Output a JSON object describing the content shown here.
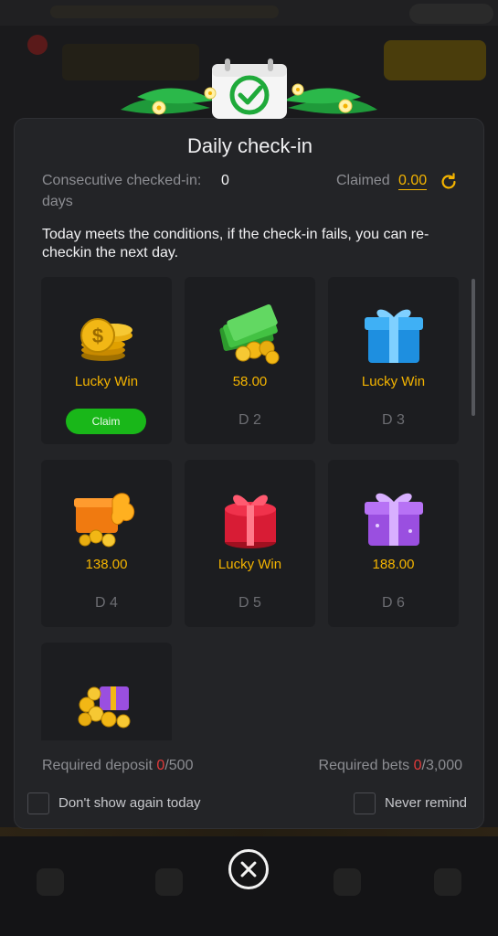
{
  "modal": {
    "title": "Daily check-in",
    "consecutive_label": "Consecutive checked-in:",
    "consecutive_value": "0",
    "consecutive_unit": "days",
    "claimed_label": "Claimed",
    "claimed_value": "0.00",
    "description": "Today meets the conditions, if the check-in fails, you can re-checkin the next day.",
    "cards": [
      {
        "amount": "Lucky Win",
        "button": "Claim",
        "day": ""
      },
      {
        "amount": "58.00",
        "day": "D 2"
      },
      {
        "amount": "Lucky Win",
        "day": "D 3"
      },
      {
        "amount": "138.00",
        "day": "D 4"
      },
      {
        "amount": "Lucky Win",
        "day": "D 5"
      },
      {
        "amount": "188.00",
        "day": "D 6"
      },
      {
        "amount": "",
        "day": ""
      }
    ],
    "required_deposit_label": "Required deposit",
    "required_deposit_current": "0",
    "required_deposit_target": "/500",
    "required_bets_label": "Required bets",
    "required_bets_current": "0",
    "required_bets_target": "/3,000",
    "dont_show_label": "Don't show again today",
    "never_remind_label": "Never remind"
  },
  "colors": {
    "accent": "#f4b400",
    "claim_green": "#19b719",
    "required_red": "#e23a3a",
    "modal_bg": "#232427"
  },
  "icons": {
    "header": "calendar-check-icon",
    "refresh": "refresh-icon",
    "close": "close-icon"
  }
}
